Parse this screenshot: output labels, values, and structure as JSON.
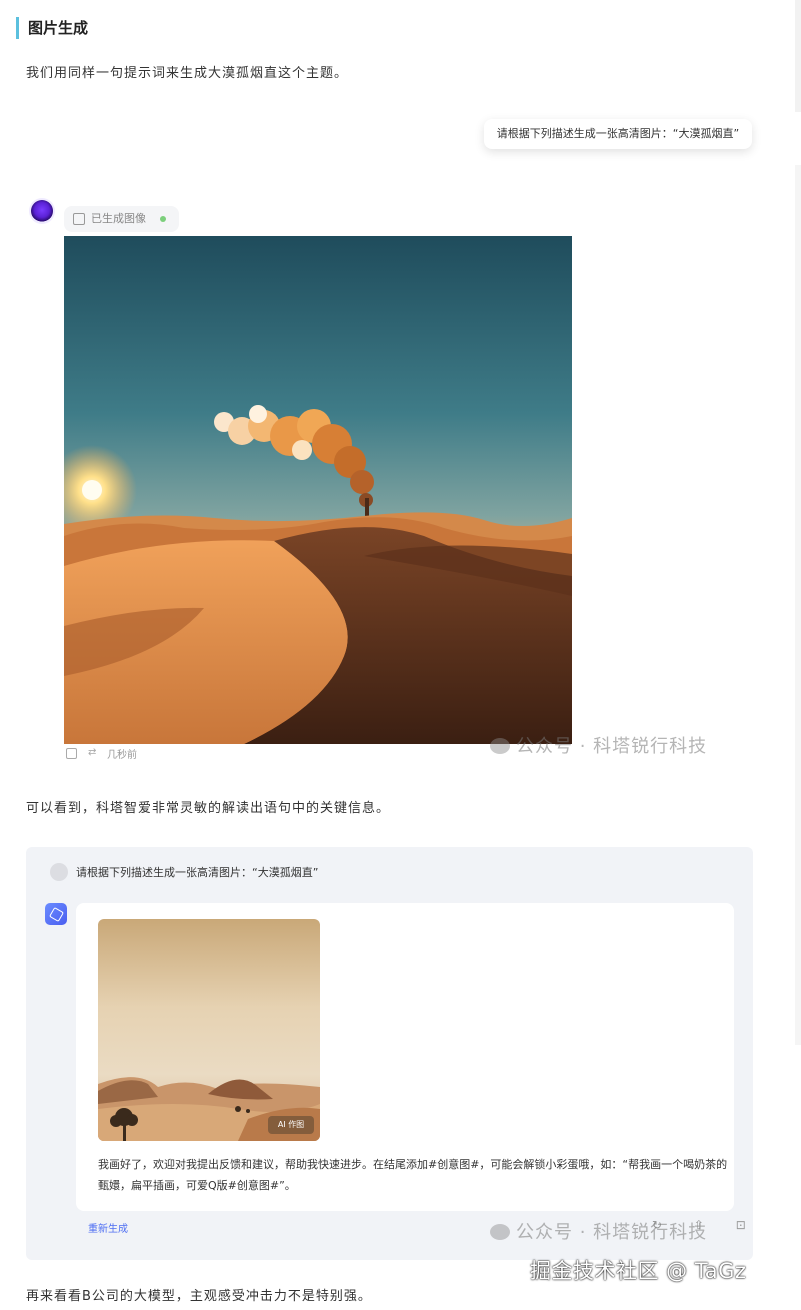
{
  "section": {
    "title": "图片生成"
  },
  "paragraphs": {
    "intro": "我们用同样一句提示词来生成大漠孤烟直这个主题。",
    "middle": "可以看到，科塔智爱非常灵敏的解读出语句中的关键信息。",
    "bottom": "再来看看B公司的大模型，主观感受冲击力不是特别强。"
  },
  "chat_a": {
    "prompt": "请根据下列描述生成一张高清图片：“大漠孤烟直”",
    "status_chip": "已生成图像",
    "timestamp": "几秒前",
    "image_desc": "desert-smoke-sunset"
  },
  "chat_b": {
    "prompt": "请根据下列描述生成一张高清图片：“大漠孤烟直”",
    "ai_badge": "AI 作图",
    "answer": "我画好了，欢迎对我提出反馈和建议，帮助我快速进步。在结尾添加#创意图#，可能会解锁小彩蛋哦，如：“帮我画一个喝奶茶的甄嬛，扁平插画，可爱Q版#创意图#”。",
    "regenerate": "重新生成",
    "action_icons": "↻ ⇧ ⊡"
  },
  "watermarks": {
    "wechat_1": "公众号 · 科塔锐行科技",
    "wechat_2": "公众号 · 科塔锐行科技",
    "juejin": "掘金技术社区 @ TaGz"
  },
  "colors": {
    "accent_bar": "#5bc0de",
    "link_blue": "#4e6ef2",
    "panel_bg": "#f1f3f7"
  }
}
